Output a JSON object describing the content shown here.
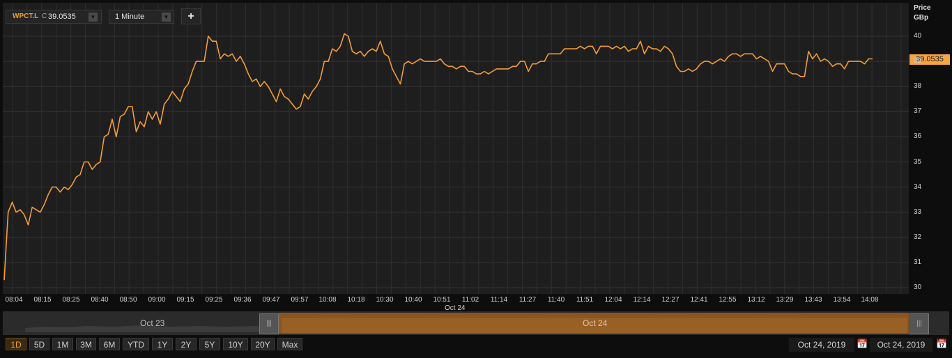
{
  "header": {
    "symbol": "WPCT.L",
    "quote_prefix": "C",
    "quote_value": "39.0535",
    "interval": "1 Minute",
    "add_label": "+"
  },
  "axis": {
    "price_label": "Price",
    "currency_label": "GBp",
    "current_tag": "39.0535",
    "date_label": "Oct 24"
  },
  "timeline": {
    "left_label": "Oct 23",
    "right_label": "Oct 24",
    "handle_glyph": "|||"
  },
  "range_buttons": [
    "1D",
    "5D",
    "1M",
    "3M",
    "6M",
    "YTD",
    "1Y",
    "2Y",
    "5Y",
    "10Y",
    "20Y",
    "Max"
  ],
  "active_range": "1D",
  "dates": {
    "from": "Oct 24, 2019",
    "to": "Oct 24, 2019"
  },
  "colors": {
    "line": "#f39c3a",
    "tag_bg": "#f5a445",
    "accent": "#f0a030",
    "timeline_fill": "#8a5520"
  },
  "chart_data": {
    "type": "line",
    "title": "",
    "xlabel": "",
    "ylabel": "Price GBp",
    "ylim": [
      29.8,
      40.6
    ],
    "y_ticks": [
      30,
      31,
      32,
      33,
      34,
      35,
      36,
      37,
      38,
      39,
      40
    ],
    "x_ticks": [
      "08:04",
      "08:15",
      "08:25",
      "08:40",
      "08:50",
      "09:00",
      "09:15",
      "09:25",
      "09:36",
      "09:47",
      "09:57",
      "10:08",
      "10:18",
      "10:30",
      "10:40",
      "10:51",
      "11:02",
      "11:14",
      "11:27",
      "11:40",
      "11:51",
      "12:04",
      "12:14",
      "12:27",
      "12:41",
      "12:55",
      "13:12",
      "13:29",
      "13:43",
      "13:54",
      "14:08"
    ],
    "grid": true,
    "series": [
      {
        "values": [
          30.3,
          33.0,
          33.4,
          33.0,
          33.1,
          32.9,
          32.5,
          33.2,
          33.1,
          33.0,
          33.3,
          33.7,
          34.0,
          34.0,
          33.8,
          34.0,
          33.9,
          34.1,
          34.4,
          34.5,
          35.0,
          35.0,
          34.7,
          34.9,
          35.0,
          36.0,
          36.1,
          36.7,
          36.0,
          36.8,
          36.9,
          37.2,
          37.2,
          36.2,
          36.6,
          36.4,
          37.0,
          36.7,
          37.0,
          36.5,
          37.3,
          37.5,
          37.8,
          37.6,
          37.4,
          37.9,
          38.1,
          38.6,
          39.0,
          39.0,
          39.0,
          40.0,
          39.8,
          39.8,
          39.1,
          39.3,
          39.2,
          39.3,
          39.0,
          39.2,
          38.9,
          38.5,
          38.2,
          38.3,
          38.0,
          38.2,
          38.0,
          37.7,
          37.4,
          37.9,
          37.6,
          37.5,
          37.3,
          37.1,
          37.2,
          37.7,
          37.5,
          37.8,
          38.0,
          38.3,
          39.0,
          39.0,
          39.5,
          39.4,
          39.6,
          40.1,
          40.0,
          39.4,
          39.3,
          39.4,
          39.2,
          39.4,
          39.5,
          39.4,
          39.8,
          39.3,
          39.2,
          38.7,
          38.4,
          38.1,
          38.9,
          39.0,
          38.9,
          39.0,
          39.1,
          39.0,
          39.0,
          39.0,
          39.0,
          39.1,
          38.9,
          38.8,
          38.8,
          38.7,
          38.8,
          38.8,
          38.6,
          38.6,
          38.5,
          38.5,
          38.6,
          38.5,
          38.6,
          38.7,
          38.7,
          38.7,
          38.7,
          38.8,
          38.8,
          39.0,
          39.0,
          38.6,
          38.9,
          38.9,
          39.0,
          39.0,
          39.3,
          39.3,
          39.3,
          39.3,
          39.5,
          39.5,
          39.5,
          39.5,
          39.6,
          39.5,
          39.6,
          39.6,
          39.3,
          39.6,
          39.6,
          39.6,
          39.5,
          39.6,
          39.5,
          39.6,
          39.4,
          39.5,
          39.5,
          39.8,
          39.3,
          39.6,
          39.5,
          39.5,
          39.4,
          39.6,
          39.5,
          39.3,
          38.8,
          38.6,
          38.6,
          38.7,
          38.6,
          38.7,
          38.9,
          39.0,
          39.0,
          38.9,
          39.0,
          39.1,
          39.0,
          39.2,
          39.3,
          39.3,
          39.2,
          39.3,
          39.3,
          39.3,
          39.1,
          39.2,
          39.1,
          39.0,
          38.6,
          38.9,
          38.9,
          38.9,
          38.6,
          38.5,
          38.5,
          38.4,
          38.4,
          39.4,
          39.1,
          39.3,
          39.0,
          39.1,
          39.0,
          38.8,
          38.9,
          38.9,
          38.7,
          39.0,
          39.0,
          39.0,
          39.0,
          38.9,
          39.1,
          39.1
        ]
      }
    ]
  }
}
